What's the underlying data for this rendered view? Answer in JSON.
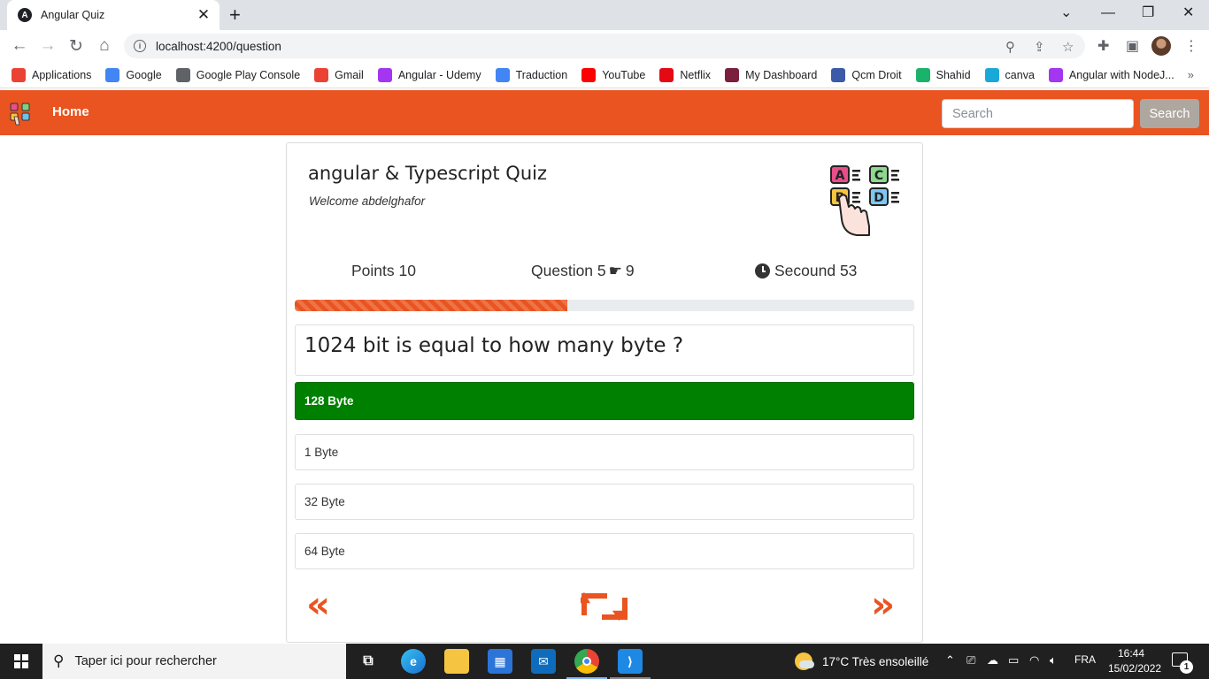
{
  "browser": {
    "tab_title": "Angular Quiz",
    "tab_favicon": "A",
    "new_tab": "+",
    "url": "localhost:4200/question",
    "bookmarks": [
      {
        "label": "Applications",
        "icon": "apps-grid-icon",
        "color": "#ea4335"
      },
      {
        "label": "Google",
        "icon": "google-icon",
        "color": "#4285f4"
      },
      {
        "label": "Google Play Console",
        "icon": "play-console-icon",
        "color": "#5f6368"
      },
      {
        "label": "Gmail",
        "icon": "gmail-icon",
        "color": "#ea4335"
      },
      {
        "label": "Angular -  Udemy",
        "icon": "udemy-icon",
        "color": "#a435f0"
      },
      {
        "label": "Traduction",
        "icon": "translate-icon",
        "color": "#4285f4"
      },
      {
        "label": "YouTube",
        "icon": "youtube-icon",
        "color": "#ff0000"
      },
      {
        "label": "Netflix",
        "icon": "netflix-icon",
        "color": "#e50914"
      },
      {
        "label": "My Dashboard",
        "icon": "dashboard-icon",
        "color": "#7a1f3d"
      },
      {
        "label": "Qcm Droit",
        "icon": "forms-icon",
        "color": "#3d5aa8"
      },
      {
        "label": "Shahid",
        "icon": "shahid-icon",
        "color": "#1bb36b"
      },
      {
        "label": "canva",
        "icon": "canva-icon",
        "color": "#19a8d8"
      },
      {
        "label": "Angular with NodeJ...",
        "icon": "udemy-icon",
        "color": "#a435f0"
      }
    ],
    "bookmarks_more": "»"
  },
  "navbar": {
    "home_label": "Home",
    "search_placeholder": "Search",
    "search_button": "Search",
    "brand_color": "#e95420"
  },
  "quiz": {
    "title": "angular & Typescript Quiz",
    "welcome": "Welcome abdelghafor",
    "points_label": "Points 10",
    "question_label": "Question 5",
    "question_total": "9",
    "seconds_label": "Secound 53",
    "progress": 0.44,
    "question_text": "1024 bit is equal to how many byte ?",
    "options": [
      {
        "label": "128 Byte",
        "selected": true
      },
      {
        "label": "1 Byte",
        "selected": false
      },
      {
        "label": "32 Byte",
        "selected": false
      },
      {
        "label": "64 Byte",
        "selected": false
      }
    ],
    "selected_color": "#008000",
    "prev_icon": "«",
    "next_icon": "»"
  },
  "taskbar": {
    "search_placeholder": "Taper ici pour rechercher",
    "weather": "17°C  Très ensoleillé",
    "language": "FRA",
    "time": "16:44",
    "date": "15/02/2022",
    "notifications": "1"
  }
}
